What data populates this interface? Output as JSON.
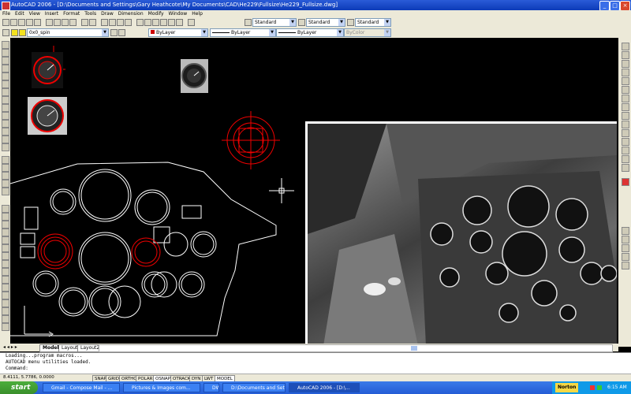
{
  "window": {
    "title": "AutoCAD 2006 - [D:\\Documents and Settings\\Gary Heathcote\\My Documents\\CAD\\He229\\Fullsize\\He229_Fullsize.dwg]"
  },
  "menu": [
    "File",
    "Edit",
    "View",
    "Insert",
    "Format",
    "Tools",
    "Draw",
    "Dimension",
    "Modify",
    "Window",
    "Help"
  ],
  "toolbar": {
    "style1": "Standard",
    "style2": "Standard",
    "style3": "Standard",
    "layer": "0x0_spin",
    "color": "ByLayer",
    "linetype": "ByLayer",
    "lineweight": "ByLayer",
    "plotstyle": "ByColor"
  },
  "tabs": [
    "Model",
    "Layout1",
    "Layout2"
  ],
  "command": {
    "lines": [
      "Loading...program macros...",
      "AUTOCAD menu utilities loaded."
    ],
    "prompt": "Command:"
  },
  "status": {
    "coords": "8.4111, 5.7786, 0.0000",
    "buttons": [
      "SNAP",
      "GRID",
      "ORTHO",
      "POLAR",
      "OSNAP",
      "OTRACK",
      "DYN",
      "LWT",
      "MODEL"
    ]
  },
  "taskbar": {
    "start": "start",
    "items": [
      "Gmail - Compose Mail - ...",
      "Pictures & Images com...",
      "DW...",
      "D:\\Documents and Sett...",
      "AutoCAD 2006 - [D:\\..."
    ],
    "norton": "Norton",
    "time": "6:15 AM"
  }
}
